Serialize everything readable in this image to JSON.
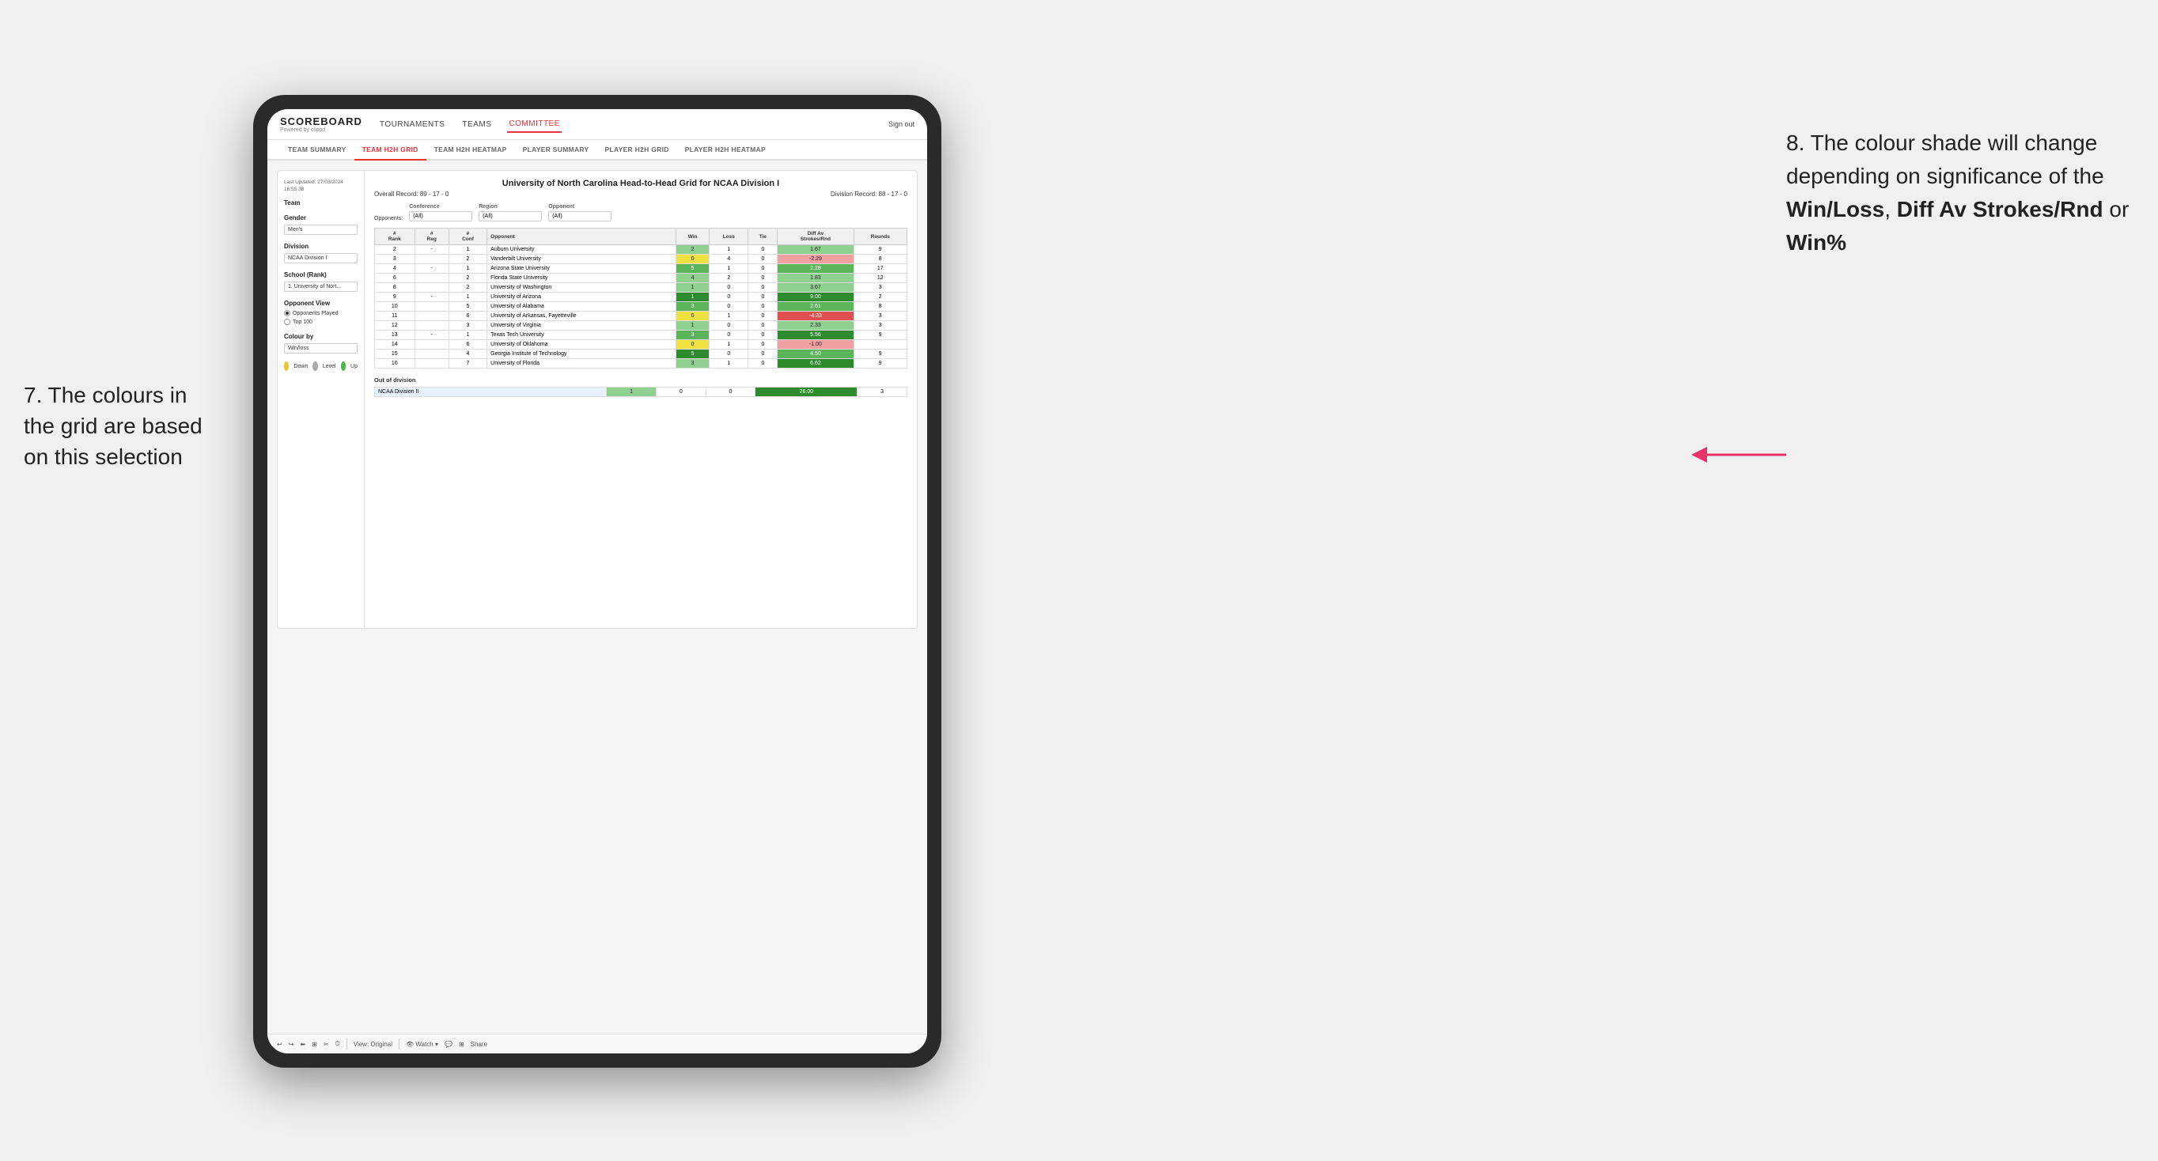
{
  "annotations": {
    "left": {
      "line1": "7. The colours in",
      "line2": "the grid are based",
      "line3": "on this selection"
    },
    "right": {
      "intro": "8. The colour shade will change depending on significance of the ",
      "bold1": "Win/Loss",
      "sep1": ", ",
      "bold2": "Diff Av Strokes/Rnd",
      "sep2": " or ",
      "bold3": "Win%"
    }
  },
  "header": {
    "logo": "SCOREBOARD",
    "logo_sub": "Powered by clippd",
    "nav": [
      "TOURNAMENTS",
      "TEAMS",
      "COMMITTEE"
    ],
    "sign_out": "Sign out"
  },
  "sub_tabs": [
    "TEAM SUMMARY",
    "TEAM H2H GRID",
    "TEAM H2H HEATMAP",
    "PLAYER SUMMARY",
    "PLAYER H2H GRID",
    "PLAYER H2H HEATMAP"
  ],
  "active_sub_tab": "TEAM H2H GRID",
  "left_panel": {
    "last_updated_label": "Last Updated: 27/03/2024",
    "last_updated_time": "16:55:38",
    "team_label": "Team",
    "gender_label": "Gender",
    "gender_value": "Men's",
    "division_label": "Division",
    "division_value": "NCAA Division I",
    "school_rank_label": "School (Rank)",
    "school_rank_value": "1. University of Nort...",
    "opponent_view_label": "Opponent View",
    "opponent_view_options": [
      "Opponents Played",
      "Top 100"
    ],
    "colour_by_label": "Colour by",
    "colour_by_value": "Win/loss",
    "legend": [
      {
        "color": "#e8c830",
        "label": "Down"
      },
      {
        "color": "#aaaaaa",
        "label": "Level"
      },
      {
        "color": "#44bb44",
        "label": "Up"
      }
    ]
  },
  "grid": {
    "title": "University of North Carolina Head-to-Head Grid for NCAA Division I",
    "overall_record_label": "Overall Record:",
    "overall_record": "89 - 17 - 0",
    "division_record_label": "Division Record:",
    "division_record": "88 - 17 - 0",
    "filters": {
      "conference_label": "Conference",
      "conference_value": "(All)",
      "region_label": "Region",
      "region_value": "(All)",
      "opponent_label": "Opponent",
      "opponent_value": "(All)",
      "opponents_label": "Opponents:"
    },
    "table_headers": [
      "#\nRank",
      "#\nReg",
      "#\nConf",
      "Opponent",
      "Win",
      "Loss",
      "Tie",
      "Diff Av\nStrokes/Rnd",
      "Rounds"
    ],
    "rows": [
      {
        "rank": "2",
        "reg": "-",
        "conf": "1",
        "opponent": "Auburn University",
        "win": "2",
        "loss": "1",
        "tie": "0",
        "diff": "1.67",
        "rounds": "9",
        "win_color": "green-light",
        "diff_color": "green-light"
      },
      {
        "rank": "3",
        "reg": "",
        "conf": "2",
        "opponent": "Vanderbilt University",
        "win": "0",
        "loss": "4",
        "tie": "0",
        "diff": "-2.29",
        "rounds": "8",
        "win_color": "yellow",
        "diff_color": "red-light"
      },
      {
        "rank": "4",
        "reg": "-",
        "conf": "1",
        "opponent": "Arizona State University",
        "win": "5",
        "loss": "1",
        "tie": "0",
        "diff": "2.28",
        "rounds": "17",
        "win_color": "green-med",
        "diff_color": "green-med"
      },
      {
        "rank": "6",
        "reg": "",
        "conf": "2",
        "opponent": "Florida State University",
        "win": "4",
        "loss": "2",
        "tie": "0",
        "diff": "1.83",
        "rounds": "12",
        "win_color": "green-light",
        "diff_color": "green-light"
      },
      {
        "rank": "8",
        "reg": "",
        "conf": "2",
        "opponent": "University of Washington",
        "win": "1",
        "loss": "0",
        "tie": "0",
        "diff": "3.67",
        "rounds": "3",
        "win_color": "green-light",
        "diff_color": "green-light"
      },
      {
        "rank": "9",
        "reg": "-",
        "conf": "1",
        "opponent": "University of Arizona",
        "win": "1",
        "loss": "0",
        "tie": "0",
        "diff": "9.00",
        "rounds": "2",
        "win_color": "green-dark",
        "diff_color": "green-dark"
      },
      {
        "rank": "10",
        "reg": "",
        "conf": "5",
        "opponent": "University of Alabama",
        "win": "3",
        "loss": "0",
        "tie": "0",
        "diff": "2.61",
        "rounds": "8",
        "win_color": "green-med",
        "diff_color": "green-med"
      },
      {
        "rank": "11",
        "reg": "",
        "conf": "6",
        "opponent": "University of Arkansas, Fayetteville",
        "win": "0",
        "loss": "1",
        "tie": "0",
        "diff": "-4.33",
        "rounds": "3",
        "win_color": "yellow",
        "diff_color": "red-med"
      },
      {
        "rank": "12",
        "reg": "",
        "conf": "3",
        "opponent": "University of Virginia",
        "win": "1",
        "loss": "0",
        "tie": "0",
        "diff": "2.33",
        "rounds": "3",
        "win_color": "green-light",
        "diff_color": "green-light"
      },
      {
        "rank": "13",
        "reg": "-",
        "conf": "1",
        "opponent": "Texas Tech University",
        "win": "3",
        "loss": "0",
        "tie": "0",
        "diff": "5.56",
        "rounds": "9",
        "win_color": "green-med",
        "diff_color": "green-dark"
      },
      {
        "rank": "14",
        "reg": "",
        "conf": "6",
        "opponent": "University of Oklahoma",
        "win": "0",
        "loss": "1",
        "tie": "0",
        "diff": "-1.00",
        "rounds": "",
        "win_color": "yellow",
        "diff_color": "red-light"
      },
      {
        "rank": "15",
        "reg": "",
        "conf": "4",
        "opponent": "Georgia Institute of Technology",
        "win": "5",
        "loss": "0",
        "tie": "0",
        "diff": "4.50",
        "rounds": "9",
        "win_color": "green-dark",
        "diff_color": "green-med"
      },
      {
        "rank": "16",
        "reg": "",
        "conf": "7",
        "opponent": "University of Florida",
        "win": "3",
        "loss": "1",
        "tie": "0",
        "diff": "6.62",
        "rounds": "9",
        "win_color": "green-light",
        "diff_color": "green-dark"
      }
    ],
    "out_of_division_label": "Out of division",
    "out_of_division_rows": [
      {
        "label": "NCAA Division II",
        "win": "1",
        "loss": "0",
        "tie": "0",
        "diff": "26.00",
        "rounds": "3",
        "diff_color": "green-dark"
      }
    ]
  },
  "toolbar": {
    "view_label": "View: Original",
    "watch_label": "Watch",
    "share_label": "Share"
  }
}
